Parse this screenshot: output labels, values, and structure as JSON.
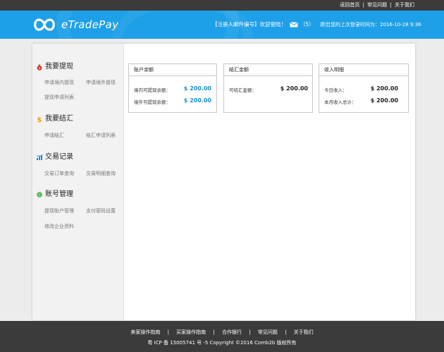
{
  "topbar": {
    "links": [
      "返回首页",
      "常见问题",
      "关于我们"
    ],
    "separator": "|"
  },
  "header": {
    "logo_text": "eTradePay",
    "welcome": "【注册人邮件编号】欢迎登陆！",
    "mail_count": "（5）",
    "logout": "退出",
    "last_login": "您的上次登录时间为：2016-10-28  9:36"
  },
  "sidebar": {
    "sections": [
      {
        "title": "我要提现",
        "icon": "money-bag-icon",
        "links": [
          "申请境内提现",
          "申请境外提现",
          "提现申请列表"
        ]
      },
      {
        "title": "我要结汇",
        "icon": "dollar-icon",
        "links": [
          "申请结汇",
          "结汇申请列表"
        ]
      },
      {
        "title": "交易记录",
        "icon": "chart-icon",
        "links": [
          "交易订单查询",
          "交易明细查询"
        ]
      },
      {
        "title": "账号管理",
        "icon": "gear-icon",
        "links": [
          "提现账户管理",
          "支付密码设置",
          "修改企业资料"
        ]
      }
    ]
  },
  "cards": {
    "balance": {
      "title": "账户余额",
      "rows": [
        {
          "label": "境内可提现余额：",
          "value": "$ 200.00"
        },
        {
          "label": "境外可提现余额：",
          "value": "$ 200.00"
        }
      ]
    },
    "exchange": {
      "title": "结汇金额",
      "rows": [
        {
          "label": "可结汇金额：",
          "value": "$ 200.00"
        }
      ]
    },
    "income": {
      "title": "收入明细",
      "rows": [
        {
          "label": "今日收入：",
          "value": "$ 200.00"
        },
        {
          "label": "本月收入总计：",
          "value": "$ 200.00"
        }
      ]
    }
  },
  "footer": {
    "links": [
      "卖家操作指南",
      "买家操作指南",
      "合作银行",
      "常见问题",
      "关于我们"
    ],
    "separator": "|",
    "copyright": "粤 ICP 备 15005741 号 -5 Copyright ©2016 Comb2b 版权所有"
  },
  "colors": {
    "header_bg": "#1ea0e8",
    "topbar_bg": "#3b3b3b",
    "accent_amount": "#1a8fd6"
  }
}
